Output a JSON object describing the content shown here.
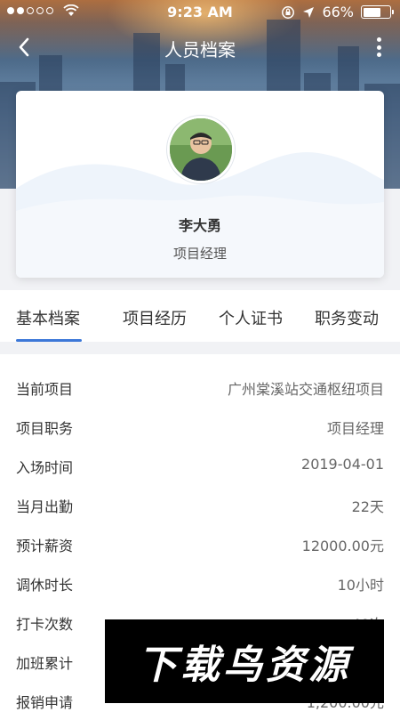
{
  "status_bar": {
    "time": "9:23 AM",
    "battery": "66%",
    "battery_level": 0.66
  },
  "nav": {
    "title": "人员档案",
    "back_icon": "chevron-left-icon",
    "more_icon": "more-vertical-icon"
  },
  "profile": {
    "name": "李大勇",
    "role": "项目经理"
  },
  "tabs": [
    {
      "label": "基本档案",
      "active": true
    },
    {
      "label": "项目经历",
      "active": false
    },
    {
      "label": "个人证书",
      "active": false
    },
    {
      "label": "职务变动",
      "active": false
    }
  ],
  "info": [
    {
      "label": "当前项目",
      "value": "广州棠溪站交通枢纽项目"
    },
    {
      "label": "项目职务",
      "value": "项目经理"
    },
    {
      "label": "入场时间",
      "value": "2019-04-01"
    },
    {
      "label": "当月出勤",
      "value": "22天"
    },
    {
      "label": "预计薪资",
      "value": "12000.00元"
    },
    {
      "label": "调休时长",
      "value": "10小时"
    },
    {
      "label": "打卡次数",
      "value": "40次"
    },
    {
      "label": "加班累计",
      "value": ""
    },
    {
      "label": "报销申请",
      "value": "1,200.00元"
    }
  ],
  "watermark": "下载鸟资源",
  "colors": {
    "accent": "#3c78d8",
    "background": "#f1f2f5"
  }
}
